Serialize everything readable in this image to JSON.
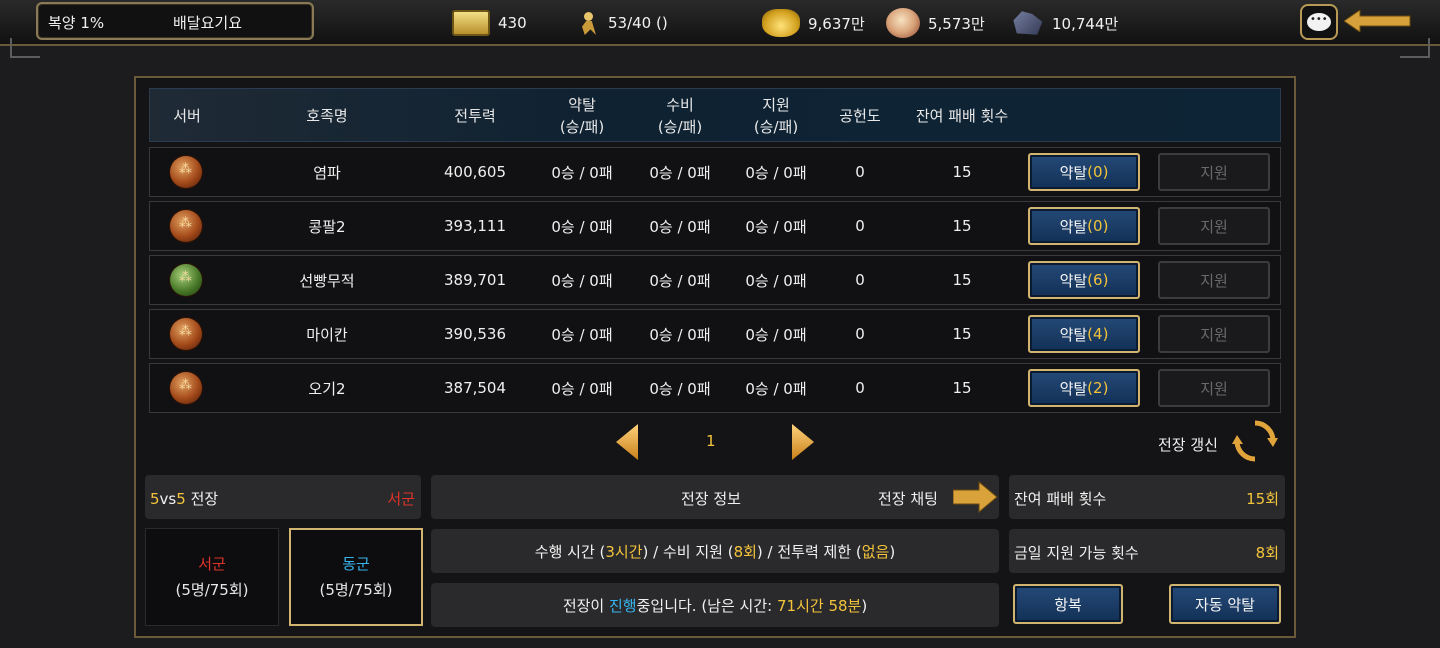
{
  "topbar": {
    "bok": "복양 1%",
    "delivery": "배달요기요",
    "scroll_count": "430",
    "stamina": "53/40 ()",
    "gold": "9,637만",
    "food": "5,573만",
    "ore": "10,744만",
    "chat_icon": "chat-bubble",
    "back_icon": "arrow-left"
  },
  "table": {
    "headers": {
      "server": "서버",
      "clan": "호족명",
      "power": "전투력",
      "plunder_1": "약탈",
      "plunder_2": "(승/패)",
      "defense_1": "수비",
      "defense_2": "(승/패)",
      "support_1": "지원",
      "support_2": "(승/패)",
      "contribution": "공헌도",
      "remaining": "잔여 패배 횟수"
    },
    "rows": [
      {
        "emblem": "orange",
        "name": "염파",
        "power": "400,605",
        "plunder": "0승 / 0패",
        "defense": "0승 / 0패",
        "support": "0승 / 0패",
        "contribution": "0",
        "remaining": "15",
        "btn_label": "약탈",
        "btn_count": "(0)",
        "support_btn": "지원"
      },
      {
        "emblem": "orange",
        "name": "콩팔2",
        "power": "393,111",
        "plunder": "0승 / 0패",
        "defense": "0승 / 0패",
        "support": "0승 / 0패",
        "contribution": "0",
        "remaining": "15",
        "btn_label": "약탈",
        "btn_count": "(0)",
        "support_btn": "지원"
      },
      {
        "emblem": "green",
        "name": "선빵무적",
        "power": "389,701",
        "plunder": "0승 / 0패",
        "defense": "0승 / 0패",
        "support": "0승 / 0패",
        "contribution": "0",
        "remaining": "15",
        "btn_label": "약탈",
        "btn_count": "(6)",
        "support_btn": "지원"
      },
      {
        "emblem": "orange",
        "name": "마이칸",
        "power": "390,536",
        "plunder": "0승 / 0패",
        "defense": "0승 / 0패",
        "support": "0승 / 0패",
        "contribution": "0",
        "remaining": "15",
        "btn_label": "약탈",
        "btn_count": "(4)",
        "support_btn": "지원"
      },
      {
        "emblem": "orange",
        "name": "오기2",
        "power": "387,504",
        "plunder": "0승 / 0패",
        "defense": "0승 / 0패",
        "support": "0승 / 0패",
        "contribution": "0",
        "remaining": "15",
        "btn_label": "약탈",
        "btn_count": "(2)",
        "support_btn": "지원"
      }
    ]
  },
  "pager": {
    "page": "1",
    "refresh_label": "전장 갱신"
  },
  "battle": {
    "mode_a": "5",
    "mode_vs": "vs",
    "mode_b": "5",
    "mode_suffix": " 전장",
    "side": "서군",
    "west_name": "서군",
    "west_count": "(5명/75회)",
    "east_name": "동군",
    "east_count": "(5명/75회)",
    "info_label": "전장 정보",
    "chat_label": "전장 채팅",
    "details_1": "수행 시간 (",
    "details_time": "3시간",
    "details_2": ") / 수비 지원 (",
    "details_support": "8회",
    "details_3": ") / 전투력 제한 (",
    "details_limit": "없음",
    "details_4": ")",
    "status_1": "전장이 ",
    "status_progress": "진행",
    "status_2": "중입니다. (남은 시간: ",
    "status_time": "71시간 58분",
    "status_3": ")",
    "remaining_label": "잔여 패배 횟수",
    "remaining_value": "15회",
    "support_label": "금일 지원 가능 횟수",
    "support_value": "8회",
    "surrender_btn": "항복",
    "auto_btn": "자동 약탈"
  },
  "colors": {
    "accent_gold": "#f3c33b",
    "west_red": "#e0332a",
    "east_blue": "#36b4ee",
    "button_blue": "#1b3f6a"
  }
}
